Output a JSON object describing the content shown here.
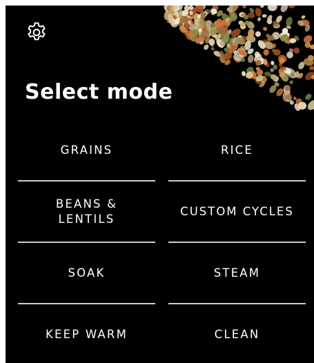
{
  "header": {
    "settings_icon": "gear-icon",
    "title": "Select mode"
  },
  "modes": [
    {
      "label": "GRAINS"
    },
    {
      "label": "RICE"
    },
    {
      "label": "BEANS & LENTILS"
    },
    {
      "label": "CUSTOM CYCLES"
    },
    {
      "label": "SOAK"
    },
    {
      "label": "STEAM"
    },
    {
      "label": "KEEP WARM"
    },
    {
      "label": "CLEAN"
    }
  ],
  "colors": {
    "background": "#000000",
    "text": "#ffffff",
    "divider": "#cfcfcf"
  }
}
